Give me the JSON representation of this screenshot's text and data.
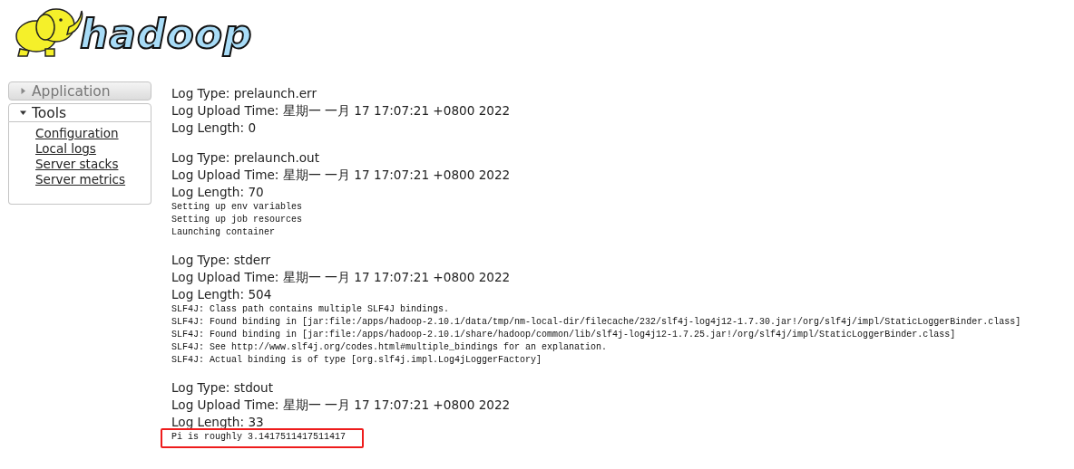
{
  "logo": {
    "text": "hadoop"
  },
  "sidebar": [
    {
      "label": "Application",
      "expanded": false
    },
    {
      "label": "Tools",
      "expanded": true,
      "items": [
        "Configuration",
        "Local logs",
        "Server stacks",
        "Server metrics"
      ]
    }
  ],
  "logs": [
    {
      "type": "Log Type: prelaunch.err",
      "upload_time": "Log Upload Time: 星期一 一月 17 17:07:21 +0800 2022",
      "length": "Log Length: 0"
    },
    {
      "type": "Log Type: prelaunch.out",
      "upload_time": "Log Upload Time: 星期一 一月 17 17:07:21 +0800 2022",
      "length": "Log Length: 70",
      "lines": [
        "Setting up env variables",
        "Setting up job resources",
        "Launching container"
      ]
    },
    {
      "type": "Log Type: stderr",
      "upload_time": "Log Upload Time: 星期一 一月 17 17:07:21 +0800 2022",
      "length": "Log Length: 504",
      "lines": [
        "SLF4J: Class path contains multiple SLF4J bindings.",
        "SLF4J: Found binding in [jar:file:/apps/hadoop-2.10.1/data/tmp/nm-local-dir/filecache/232/slf4j-log4j12-1.7.30.jar!/org/slf4j/impl/StaticLoggerBinder.class]",
        "SLF4J: Found binding in [jar:file:/apps/hadoop-2.10.1/share/hadoop/common/lib/slf4j-log4j12-1.7.25.jar!/org/slf4j/impl/StaticLoggerBinder.class]",
        "SLF4J: See http://www.slf4j.org/codes.html#multiple_bindings for an explanation.",
        "SLF4J: Actual binding is of type [org.slf4j.impl.Log4jLoggerFactory]"
      ]
    },
    {
      "type": "Log Type: stdout",
      "upload_time": "Log Upload Time: 星期一 一月 17 17:07:21 +0800 2022",
      "length": "Log Length: 33",
      "lines": [
        "Pi is roughly 3.1417511417511417"
      ],
      "highlighted": true
    }
  ]
}
